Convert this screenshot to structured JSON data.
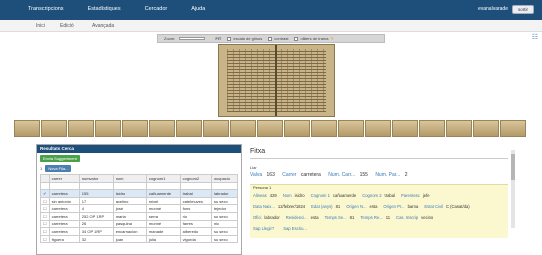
{
  "nav": {
    "items": [
      "Transcripcions",
      "Estadístiques",
      "Cercador",
      "Ajuda"
    ],
    "user": "evanalvarade",
    "exit": "sortir"
  },
  "subnav": {
    "items": [
      "Inici",
      "Edició",
      "Avançada"
    ]
  },
  "viewer": {
    "zoom_label": "Zoom:",
    "fit": "FIT",
    "opt1": "escala de grisos",
    "opt2": "contrast",
    "opt3": "nåters de trama"
  },
  "results": {
    "title": "Resultats Cerca",
    "new_suggestion": "Envia Suggeriment",
    "page": "1",
    "new_row": "Nova Fila...",
    "columns": [
      "carrer",
      "numvalor",
      "nom",
      "cognom1",
      "cognom2",
      "ocupacio"
    ],
    "rows": [
      [
        "carretera",
        "155",
        "isidro",
        "cañuamerde",
        "trabal",
        "labrador"
      ],
      [
        "sin antonio",
        "17",
        "avelino",
        "mixel",
        "catelmuves",
        "su sexo"
      ],
      [
        "carretera",
        "4",
        "josé",
        "munné",
        "fons",
        "tejedor"
      ],
      [
        "carretera",
        "252 OP 1RP",
        "maria",
        "serra",
        "riu",
        "su sexo"
      ],
      [
        "carretera",
        "26",
        "pasquina",
        "munné",
        "farres",
        "nic"
      ],
      [
        "carretera",
        "34 OP 1RP",
        "encarnacion",
        "manade",
        "alberedo",
        "su sexo"
      ],
      [
        "figuera",
        "32",
        "juan",
        "julia",
        "vigorda",
        "su sexo"
      ]
    ]
  },
  "fitxa": {
    "title": "Fitxa",
    "section_llar": "Llar",
    "via_label": "Valva",
    "via_num": "163",
    "carrer_label": "Carrer",
    "carrer_val": "carretera",
    "num_label": "Num. Carr...",
    "num_val": "155",
    "numpar_label": "Num. Par...",
    "numpar_val": "2",
    "section_persona": "Persona 1",
    "r1": [
      [
        "Alineas",
        "429"
      ],
      [
        "Nom",
        "isidro"
      ],
      [
        "Cognom 1",
        "cañuamerde"
      ],
      [
        "Cognom 2",
        "trabal"
      ],
      [
        "Parentesc",
        "jefe"
      ]
    ],
    "r2": [
      [
        "Data Naix...",
        "12/febrer/1824"
      ],
      [
        "Edat (anys)",
        "81"
      ],
      [
        "Origen N...",
        "esta"
      ],
      [
        "Origen Pr...",
        "barna"
      ],
      [
        "Estat Civil",
        "C (Casat/da)"
      ]
    ],
    "r3": [
      [
        "Ofici",
        "labrador"
      ],
      [
        "Residenci...",
        "esta"
      ],
      [
        "Temps Se...",
        "81"
      ],
      [
        "Temps Re...",
        "11"
      ],
      [
        "Cas. Inscrip",
        "vecino"
      ]
    ],
    "r4": [
      [
        "Sap Llegir?",
        ""
      ],
      [
        "Sap Escriu...",
        ""
      ]
    ]
  }
}
